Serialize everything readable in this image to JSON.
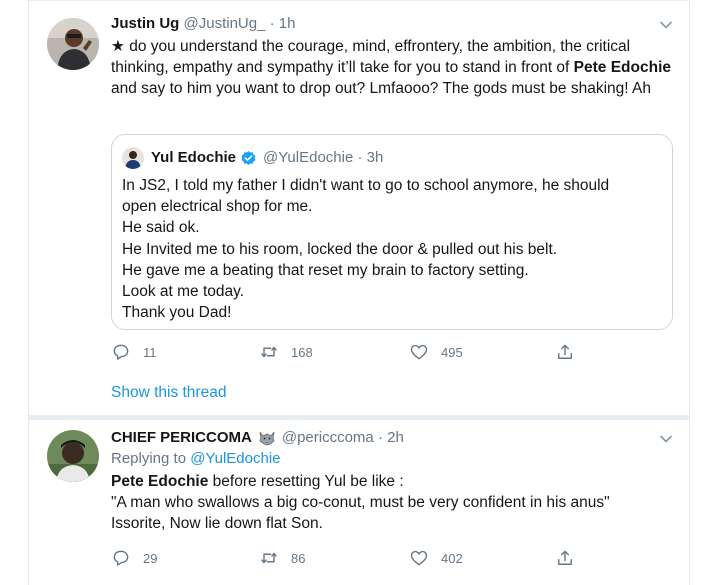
{
  "tweets": [
    {
      "author_name": "Justin Ug",
      "author_handle": "@JustinUg_",
      "separator": "·",
      "time": "1h",
      "text": {
        "part1": "★ do you understand the courage, mind, effrontery, the ambition, the critical thinking, empathy and sympathy it’ll take for you to stand  in front of ",
        "bold1": "Pete Edochie",
        "part2": " and say to him you want to drop out? Lmfaooo? The gods must be shaking! Ah"
      },
      "quote": {
        "author_name": "Yul Edochie",
        "author_handle": "@YulEdochie",
        "separator": "·",
        "time": "3h",
        "lines": [
          "In JS2, I told my father I didn't want to go to school anymore, he should",
          "open electrical shop for me.",
          "He said ok.",
          "He Invited me to his room, locked the door & pulled out his belt.",
          "He gave me a beating that reset my brain to factory setting.",
          "Look at me today.",
          "Thank you Dad!"
        ]
      },
      "actions": {
        "replies": "11",
        "retweets": "168",
        "likes": "495"
      },
      "show_thread": "Show this thread"
    },
    {
      "author_name": "CHIEF PERICCOMA",
      "author_handle": "@pericccoma",
      "separator": "·",
      "time": "2h",
      "replying_prefix": "Replying to ",
      "replying_handle": "@YulEdochie",
      "lines": {
        "bold": "Pete Edochie",
        "line1_rest": " before resetting Yul be like :",
        "line2": "\"A man who swallows a big co-conut, must be very confident in his anus\"",
        "line3": "Issorite, Now lie down flat Son."
      },
      "actions": {
        "replies": "29",
        "retweets": "86",
        "likes": "402"
      }
    }
  ],
  "colors": {
    "accent": "#1b95e0",
    "verified": "#1da1f2",
    "muted": "#657786",
    "border": "#e6ecf0"
  },
  "icons": [
    "chevron-down-icon",
    "verified-icon",
    "reply-icon",
    "retweet-icon",
    "like-icon",
    "share-icon",
    "wolf-emoji-icon"
  ]
}
